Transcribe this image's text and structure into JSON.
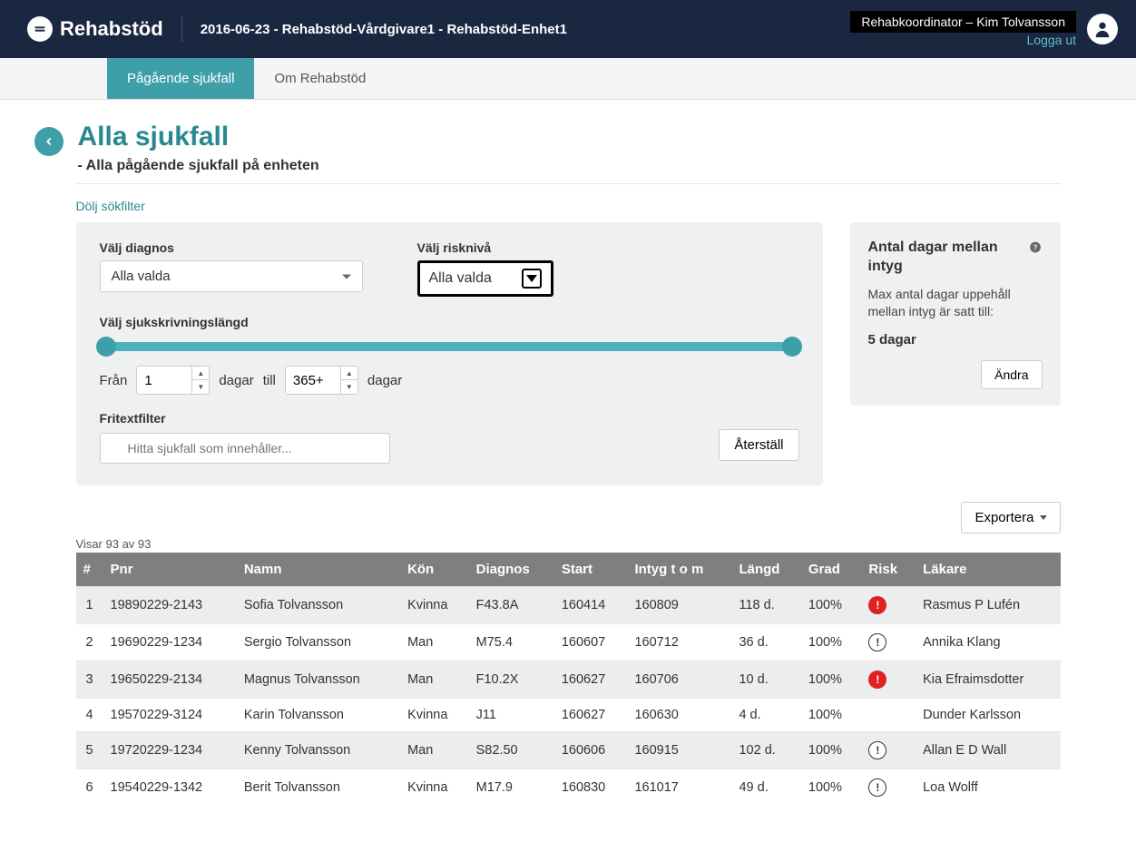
{
  "header": {
    "logo_text": "Rehabstöd",
    "breadcrumb": "2016-06-23 - Rehabstöd-Vårdgivare1 - Rehabstöd-Enhet1",
    "user_role": "Rehabkoordinator – Kim Tolvansson",
    "logout": "Logga ut"
  },
  "tabs": [
    {
      "label": "Pågående sjukfall",
      "active": true
    },
    {
      "label": "Om Rehabstöd",
      "active": false
    }
  ],
  "page": {
    "title": "Alla sjukfall",
    "subtitle": "- Alla pågående sjukfall på enheten",
    "toggle_filter": "Dölj sökfilter"
  },
  "filter": {
    "diagnosis_label": "Välj diagnos",
    "diagnosis_value": "Alla valda",
    "risk_label": "Välj risknivå",
    "risk_value": "Alla valda",
    "length_label": "Välj sjukskrivningslängd",
    "from_label": "Från",
    "from_value": "1",
    "to_label": "till",
    "to_value": "365+",
    "days_label": "dagar",
    "freetext_label": "Fritextfilter",
    "freetext_placeholder": "Hitta sjukfall som innehåller...",
    "reset_label": "Återställ"
  },
  "sidebar": {
    "title": "Antal dagar mellan intyg",
    "desc": "Max antal dagar uppehåll mellan intyg är satt till:",
    "value": "5 dagar",
    "button": "Ändra"
  },
  "export_label": "Exportera",
  "result_count": "Visar 93 av 93",
  "columns": [
    "#",
    "Pnr",
    "Namn",
    "Kön",
    "Diagnos",
    "Start",
    "Intyg t o m",
    "Längd",
    "Grad",
    "Risk",
    "Läkare"
  ],
  "rows": [
    {
      "idx": "1",
      "pnr": "19890229-2143",
      "namn": "Sofia Tolvansson",
      "kon": "Kvinna",
      "diagnos": "F43.8A",
      "start": "160414",
      "tom": "160809",
      "langd": "118 d.",
      "grad": "100%",
      "risk": "high",
      "lakare": "Rasmus P Lufén"
    },
    {
      "idx": "2",
      "pnr": "19690229-1234",
      "namn": "Sergio Tolvansson",
      "kon": "Man",
      "diagnos": "M75.4",
      "start": "160607",
      "tom": "160712",
      "langd": "36 d.",
      "grad": "100%",
      "risk": "low",
      "lakare": "Annika Klang"
    },
    {
      "idx": "3",
      "pnr": "19650229-2134",
      "namn": "Magnus Tolvansson",
      "kon": "Man",
      "diagnos": "F10.2X",
      "start": "160627",
      "tom": "160706",
      "langd": "10 d.",
      "grad": "100%",
      "risk": "high",
      "lakare": "Kia Efraimsdotter"
    },
    {
      "idx": "4",
      "pnr": "19570229-3124",
      "namn": "Karin Tolvansson",
      "kon": "Kvinna",
      "diagnos": "J11",
      "start": "160627",
      "tom": "160630",
      "langd": "4 d.",
      "grad": "100%",
      "risk": "",
      "lakare": "Dunder Karlsson"
    },
    {
      "idx": "5",
      "pnr": "19720229-1234",
      "namn": "Kenny Tolvansson",
      "kon": "Man",
      "diagnos": "S82.50",
      "start": "160606",
      "tom": "160915",
      "langd": "102 d.",
      "grad": "100%",
      "risk": "low",
      "lakare": "Allan E D Wall"
    },
    {
      "idx": "6",
      "pnr": "19540229-1342",
      "namn": "Berit Tolvansson",
      "kon": "Kvinna",
      "diagnos": "M17.9",
      "start": "160830",
      "tom": "161017",
      "langd": "49 d.",
      "grad": "100%",
      "risk": "low",
      "lakare": "Loa Wolff"
    }
  ]
}
